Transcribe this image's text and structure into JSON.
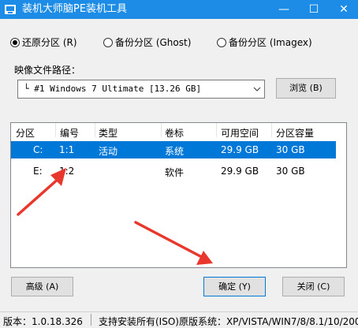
{
  "window": {
    "title": "装机大师脑PE装机工具",
    "controls": {
      "minimize": "—",
      "maximize": "☐",
      "close": "✕"
    }
  },
  "modes": [
    {
      "label": "还原分区 (R)",
      "selected": true
    },
    {
      "label": "备份分区 (Ghost)",
      "selected": false
    },
    {
      "label": "备份分区 (Imagex)",
      "selected": false
    }
  ],
  "image_path": {
    "label": "映像文件路径：",
    "value": "└  #1 Windows 7 Ultimate [13.26 GB]",
    "browse_label": "浏览 (B)"
  },
  "partitions": {
    "columns": [
      "分区",
      "编号",
      "类型",
      "卷标",
      "可用空间",
      "分区容量"
    ],
    "rows": [
      {
        "drive": "C:",
        "number": "1:1",
        "type": "活动",
        "label": "系统",
        "free": "29.9 GB",
        "capacity": "30 GB",
        "selected": true
      },
      {
        "drive": "E:",
        "number": "1:2",
        "type": "",
        "label": "软件",
        "free": "29.9 GB",
        "capacity": "30 GB",
        "selected": false
      }
    ]
  },
  "buttons": {
    "advanced": "高级 (A)",
    "ok": "确定 (Y)",
    "close": "关闭 (C)"
  },
  "status": {
    "version": "版本：1.0.18.326",
    "support": "支持安装所有(ISO)原版系统：XP/VISTA/WIN7/8/8.1/10/200"
  },
  "colors": {
    "titlebar": "#1c8ce6",
    "selection": "#0078d7",
    "arrow": "#e8372c"
  }
}
